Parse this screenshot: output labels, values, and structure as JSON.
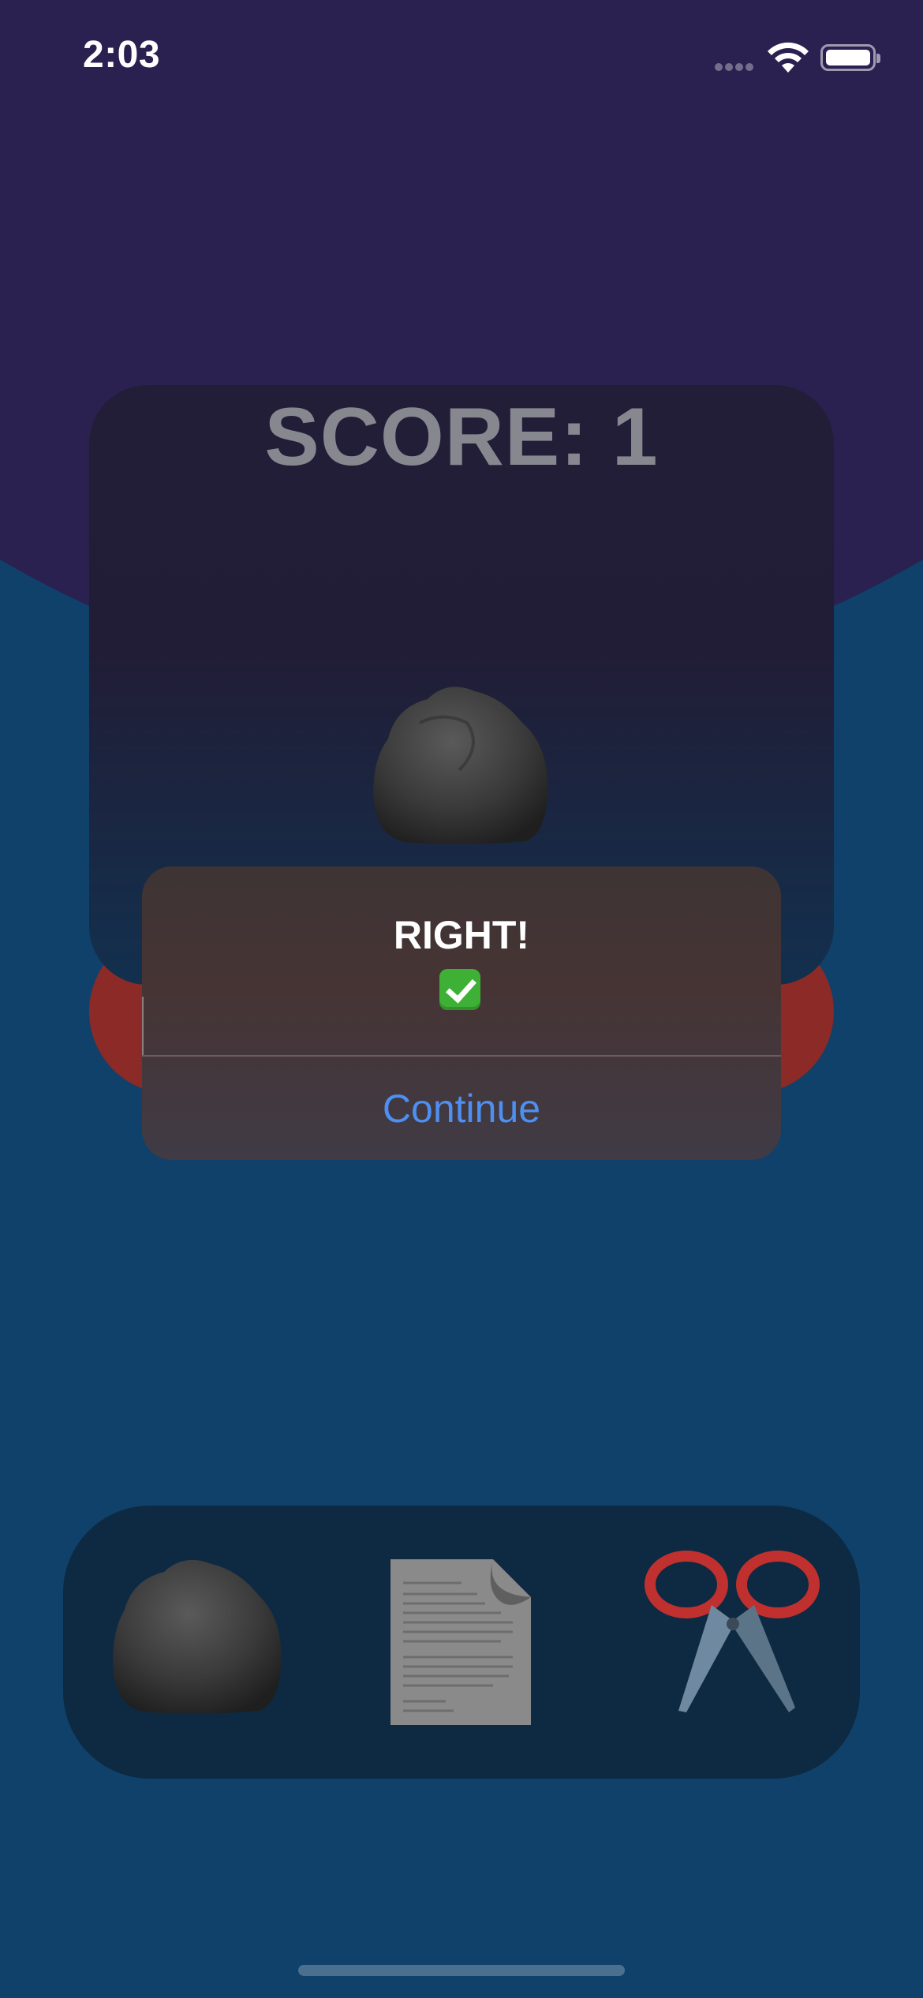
{
  "status_bar": {
    "time": "2:03"
  },
  "game": {
    "score_text": "SCORE: 1",
    "opponent_choice_icon": "rock-icon"
  },
  "alert": {
    "title": "RIGHT!",
    "icon": "check-mark-icon",
    "button_label": "Continue"
  },
  "choices": [
    {
      "name": "rock",
      "icon": "rock-icon"
    },
    {
      "name": "paper",
      "icon": "paper-icon"
    },
    {
      "name": "scissors",
      "icon": "scissors-icon"
    }
  ],
  "colors": {
    "background_top": "#2a2151",
    "background_bottom": "#0f416a",
    "card": "#221e38",
    "button_red": "#8b2a26",
    "alert_button": "#4d8ff2",
    "score_text": "#87878f"
  }
}
